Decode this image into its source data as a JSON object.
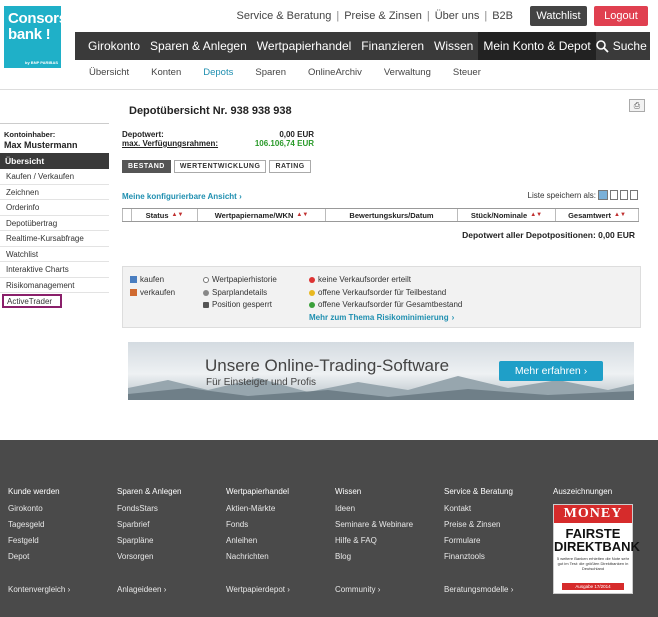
{
  "logo": {
    "line1": "Consors",
    "line2": "bank !",
    "sub": "by BNP PARIBAS"
  },
  "topnav": {
    "links": [
      "Service & Beratung",
      "Preise & Zinsen",
      "Über uns",
      "B2B"
    ],
    "watchlist": "Watchlist",
    "logout": "Logout"
  },
  "mainnav": {
    "items": [
      "Girokonto",
      "Sparen & Anlegen",
      "Wertpapierhandel",
      "Finanzieren",
      "Wissen",
      "Mein Konto & Depot"
    ],
    "search": "Suche"
  },
  "subnav": [
    "Übersicht",
    "Konten",
    "Depots",
    "Sparen",
    "OnlineArchiv",
    "Verwaltung",
    "Steuer"
  ],
  "sidebar": {
    "holder_label": "Kontoinhaber:",
    "holder_name": "Max Mustermann",
    "header": "Übersicht",
    "items": [
      "Kaufen / Verkaufen",
      "Zeichnen",
      "Orderinfo",
      "Depotübertrag",
      "Realtime-Kursabfrage",
      "Watchlist",
      "Interaktive Charts",
      "Risikomanagement",
      "ActiveTrader"
    ]
  },
  "depot": {
    "title": "Depotübersicht Nr. 938 938 938",
    "depotwert_label": "Depotwert:",
    "depotwert_value": "0,00 EUR",
    "rahmen_label": "max. Verfügungsrahmen:",
    "rahmen_value": "106.106,74 EUR",
    "tabs": [
      "BESTAND",
      "WERTENTWICKLUNG",
      "RATING"
    ],
    "config_view": "Meine konfigurierbare Ansicht",
    "save_list": "Liste speichern als:",
    "columns": [
      "Status",
      "Wertpapiername/WKN",
      "Bewertungskurs/Datum",
      "Stück/Nominale",
      "Gesamtwert"
    ],
    "total": "Depotwert aller Depotpositionen: 0,00 EUR"
  },
  "legend": {
    "kaufen": "kaufen",
    "verkaufen": "verkaufen",
    "historie": "Wertpapierhistorie",
    "sparplan": "Sparplandetails",
    "gesperrt": "Position gesperrt",
    "keine": "keine Verkaufsorder erteilt",
    "teil": "offene Verkaufsorder für Teilbestand",
    "gesamt": "offene Verkaufsorder für Gesamtbestand",
    "more": "Mehr zum Thema Risikominimierung"
  },
  "banner": {
    "headline": "Unsere Online-Trading-Software",
    "sub": "Für Einsteiger und Profis",
    "cta": "Mehr erfahren"
  },
  "footer": {
    "columns": [
      {
        "head": "Kunde werden",
        "links": [
          "Girokonto",
          "Tagesgeld",
          "Festgeld",
          "Depot"
        ],
        "bottom": "Kontenvergleich"
      },
      {
        "head": "Sparen & Anlegen",
        "links": [
          "FondsStars",
          "Sparbrief",
          "Sparpläne",
          "Vorsorgen"
        ],
        "bottom": "Anlageideen"
      },
      {
        "head": "Wertpapierhandel",
        "links": [
          "Aktien-Märkte",
          "Fonds",
          "Anleihen",
          "Nachrichten"
        ],
        "bottom": "Wertpapierdepot"
      },
      {
        "head": "Wissen",
        "links": [
          "Ideen",
          "Seminare & Webinare",
          "Hilfe & FAQ",
          "Blog"
        ],
        "bottom": "Community"
      },
      {
        "head": "Service & Beratung",
        "links": [
          "Kontakt",
          "Preise & Zinsen",
          "Formulare",
          "Finanztools"
        ],
        "bottom": "Beratungsmodelle"
      },
      {
        "head": "Auszeichnungen",
        "links": [],
        "bottom": ""
      }
    ],
    "award": {
      "brand": "MONEY",
      "title1": "FAIRSTE",
      "title2": "DIREKTBANK",
      "text": "5 weitere Banken erhielten die Note sehr gut im Test: die größten Direktbanken in Deutschland",
      "date": "Ausgabe 17/2014"
    }
  }
}
